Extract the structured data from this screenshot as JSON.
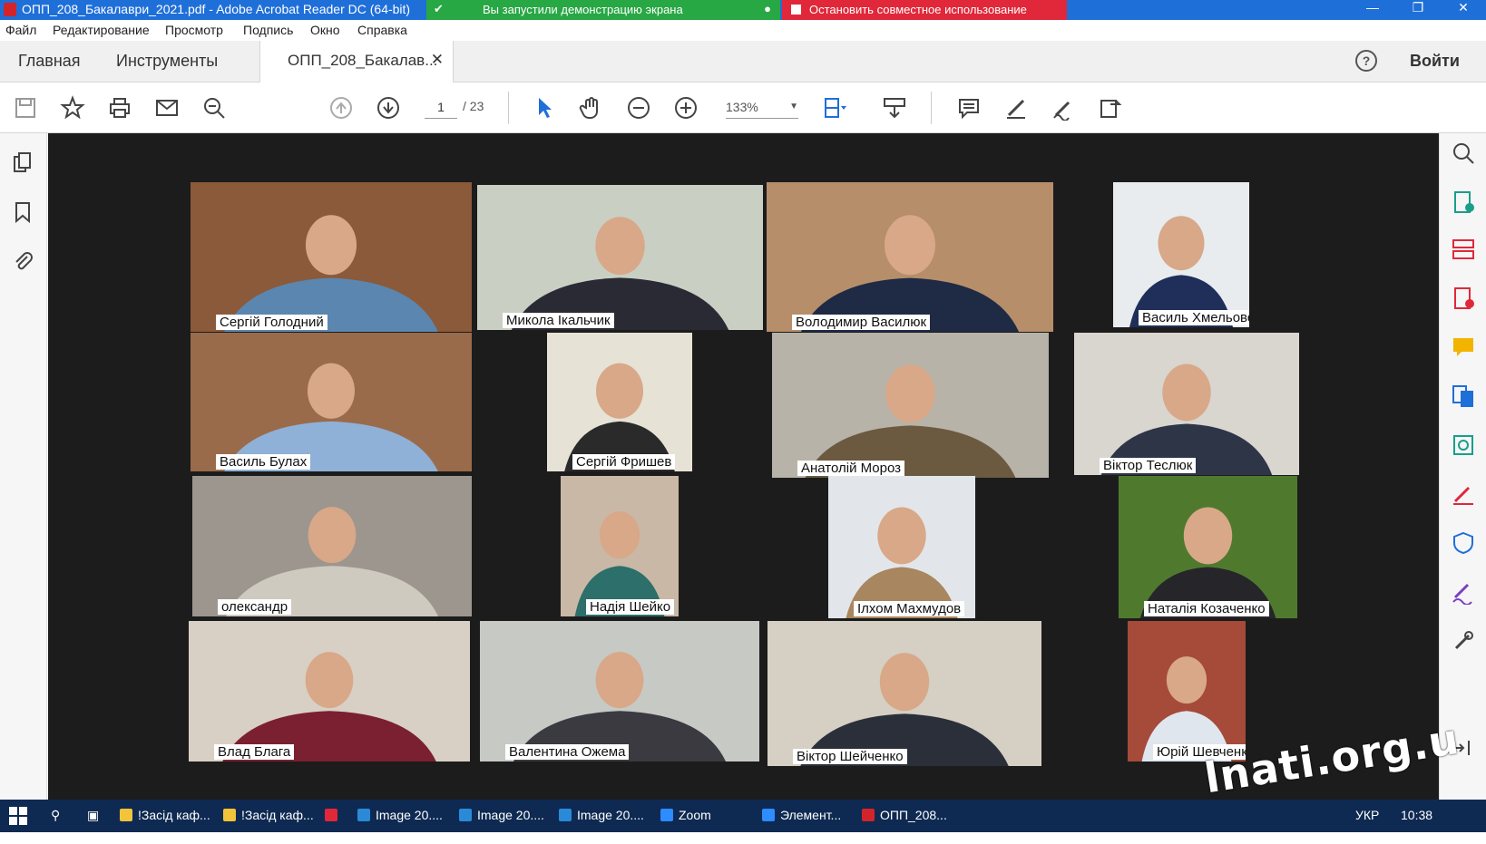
{
  "window": {
    "title": "ОПП_208_Бакалаври_2021.pdf - Adobe Acrobat Reader DC (64-bit)",
    "share_banner": "Вы запустили демонстрацию экрана",
    "stop_share": "Остановить совместное использование"
  },
  "menu": [
    "Файл",
    "Редактирование",
    "Просмотр",
    "Подпись",
    "Окно",
    "Справка"
  ],
  "tabs": {
    "home": "Главная",
    "tools": "Инструменты",
    "document": "ОПП_208_Бакалав...",
    "login": "Войти"
  },
  "toolbar": {
    "page_current": "1",
    "page_total": "/ 23",
    "zoom": "133%"
  },
  "participants": [
    {
      "name": "Сергій Голодний",
      "bg": "#8a5a3a",
      "fg": "#5b86b0",
      "active": false
    },
    {
      "name": "Микола Ікальчик",
      "bg": "#c9cfc3",
      "fg": "#2a2a35",
      "active": true
    },
    {
      "name": "Володимир Василюк",
      "bg": "#b68e6a",
      "fg": "#1f2a45",
      "active": false
    },
    {
      "name": "Василь Хмельовський",
      "bg": "#e8ecef",
      "fg": "#1f2f5a",
      "active": false
    },
    {
      "name": "Василь Булах",
      "bg": "#9a6b4a",
      "fg": "#8fb1d8",
      "active": false
    },
    {
      "name": "Сергій Фришев",
      "bg": "#e6e2d6",
      "fg": "#2a2a2a",
      "active": false
    },
    {
      "name": "Анатолій Мороз",
      "bg": "#b8b3a8",
      "fg": "#6b5a40",
      "active": false
    },
    {
      "name": "Віктор Теслюк",
      "bg": "#d9d5cf",
      "fg": "#2e3547",
      "active": false
    },
    {
      "name": "олександр",
      "bg": "#9c968e",
      "fg": "#cfcac0",
      "active": false
    },
    {
      "name": "Надія Шейко",
      "bg": "#c9b8a6",
      "fg": "#2d6f6a",
      "active": false
    },
    {
      "name": "Ілхом Махмудов",
      "bg": "#e2e6ea",
      "fg": "#a88660",
      "active": false
    },
    {
      "name": "Наталія Козаченко",
      "bg": "#4f7a2e",
      "fg": "#25252a",
      "active": false
    },
    {
      "name": "Влад Блага",
      "bg": "#d8d0c4",
      "fg": "#7a2030",
      "active": false
    },
    {
      "name": "Валентина Ожема",
      "bg": "#c6c9c4",
      "fg": "#3a3a40",
      "active": false
    },
    {
      "name": "Віктор Шейченко",
      "bg": "#d5cfc4",
      "fg": "#2a2f3a",
      "active": false
    },
    {
      "name": "Юрій Шевченко",
      "bg": "#a64a3a",
      "fg": "#dfe6ee",
      "active": false
    }
  ],
  "taskbar": [
    {
      "label": "!Засід каф...",
      "color": "#f3c33a"
    },
    {
      "label": "!Засід каф...",
      "color": "#f3c33a"
    },
    {
      "label": "",
      "color": "#e0283a"
    },
    {
      "label": "Image 20....",
      "color": "#2a8ad8"
    },
    {
      "label": "Image 20....",
      "color": "#2a8ad8"
    },
    {
      "label": "Image 20....",
      "color": "#2a8ad8"
    },
    {
      "label": "Zoom",
      "color": "#2d8cff"
    },
    {
      "label": "Элемент...",
      "color": "#2d8cff"
    },
    {
      "label": "ОПП_208...",
      "color": "#d3242b"
    }
  ],
  "tray": {
    "lang": "УКР",
    "time": "10:38"
  },
  "watermark": "lnati.org.u"
}
